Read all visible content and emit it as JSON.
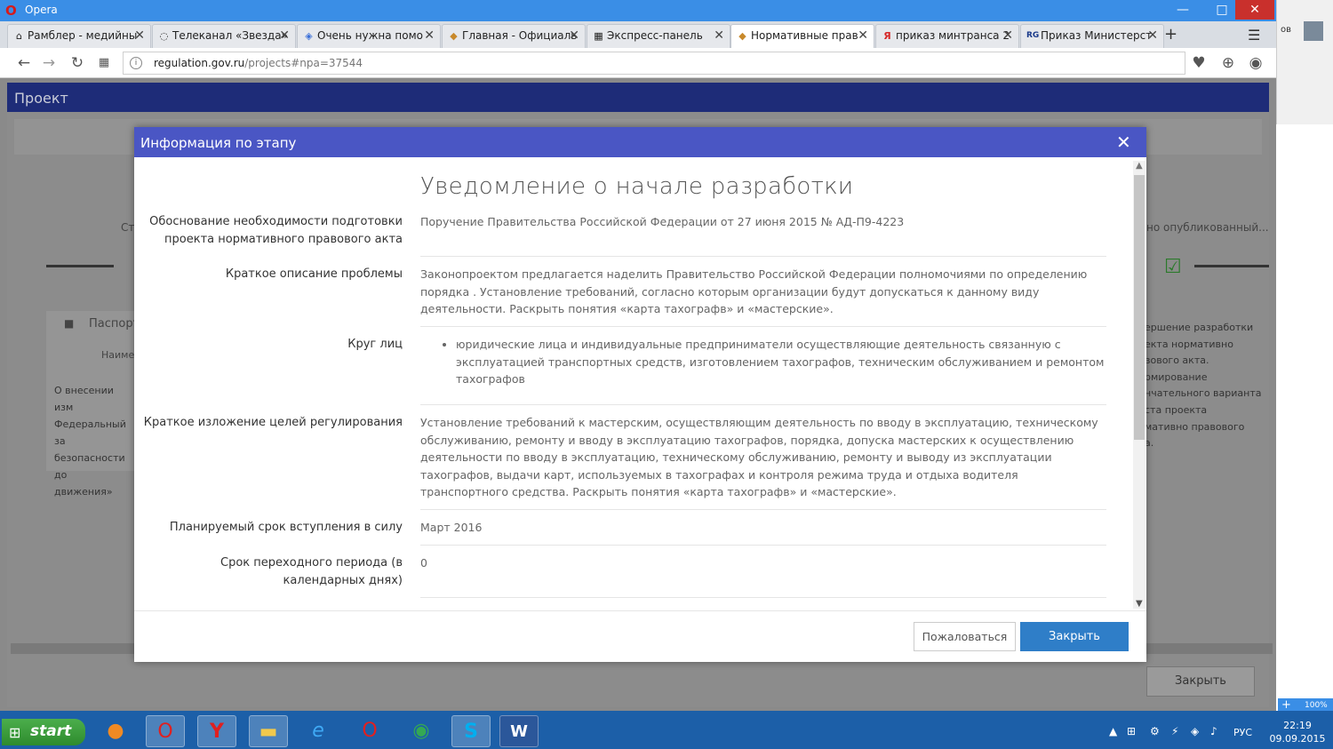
{
  "window": {
    "title": "Opera",
    "controls": {
      "minimize": "—",
      "maximize": "□",
      "close": "✕"
    }
  },
  "tabs": [
    {
      "label": "Рамблер - медийны",
      "icon": "house-icon"
    },
    {
      "label": "Телеканал «Звезда»",
      "icon": "circle-icon"
    },
    {
      "label": "Очень нужна помо",
      "icon": "diamond-icon"
    },
    {
      "label": "Главная - Официаль",
      "icon": "shield-icon"
    },
    {
      "label": "Экспресс-панель",
      "icon": "grid-icon"
    },
    {
      "label": "Нормативные прав",
      "icon": "shield-icon",
      "active": true
    },
    {
      "label": "приказ минтранса 2",
      "icon": "yandex-icon"
    },
    {
      "label": "Приказ Министерст",
      "icon": "rg-icon"
    }
  ],
  "address": {
    "domain": "regulation.gov.ru",
    "path": "/projects#npa=37544"
  },
  "background": {
    "project_title": "Проект",
    "left_texts": {
      "st": "Ст",
      "passport": "Паспорт",
      "naim": "Наиме",
      "body1": "О внесении изм",
      "body2": "Федеральный за",
      "body3": "безопасности до",
      "body4": "движения»"
    },
    "right_top": "но опубликованный...",
    "right_panel": "ершение разработки\nекта нормативно\nвового акта.\nрмирование\nнчательного варианта\nста проекта\nмативно правового\nа.",
    "close_label": "Закрыть"
  },
  "modal": {
    "title": "Информация по этапу",
    "heading": "Уведомление о начале разработки",
    "rows": [
      {
        "label": "Обоснование необходимости подготовки проекта нормативного правового акта",
        "value": "Поручение Правительства Российской Федерации от 27 июня 2015 № АД-П9-4223"
      },
      {
        "label": "Краткое описание проблемы",
        "value": "Законопроектом предлагается наделить Правительство Российской Федерации полномочиями по определению порядка . Установление требований, согласно которым организации будут допускаться к данному виду деятельности. Раскрыть понятия «карта тахографв» и «мастерские»."
      },
      {
        "label": "Круг лиц",
        "value": "юридические лица и индивидуальные предприниматели осуществляющие деятельность связанную с эксплуатацией транспортных средств, изготовлением тахографов, техническим обслуживанием и ремонтом тахографов"
      },
      {
        "label": "Краткое изложение целей регулирования",
        "value": "Установление требований к мастерским, осуществляющим деятельность по вводу в эксплуатацию, техническому обслуживанию, ремонту и вводу в эксплуатацию тахографов, порядка, допуска мастерских к осуществлению деятельности по вводу в эксплуатацию, техническому обслуживанию, ремонту и выводу из эксплуатации тахографов, выдачи карт, используемых в тахографах и контроля режима труда и отдыха водителя транспортного средства. Раскрыть понятия «карта тахографв» и «мастерские»."
      },
      {
        "label": "Планируемый срок вступления в силу",
        "value": "Март 2016"
      },
      {
        "label": "Срок переходного периода (в календарных днях)",
        "value": "0"
      }
    ],
    "complain_label": "Пожаловаться",
    "close_label": "Закрыть"
  },
  "side": {
    "top_text": "ов",
    "zoom": "100%"
  },
  "taskbar": {
    "start_label": "start",
    "apps": [
      "firefox-icon",
      "opera-icon",
      "yandex-browser-icon",
      "file-explorer-icon",
      "ie-icon",
      "opera-icon",
      "chrome-icon",
      "skype-icon",
      "word-icon"
    ],
    "lang": "РУС",
    "time": "22:19",
    "date": "09.09.2015"
  },
  "colors": {
    "modal_header": "#4a56c4",
    "primary_button": "#2f7ec8",
    "project_bar": "#1e2c78"
  }
}
